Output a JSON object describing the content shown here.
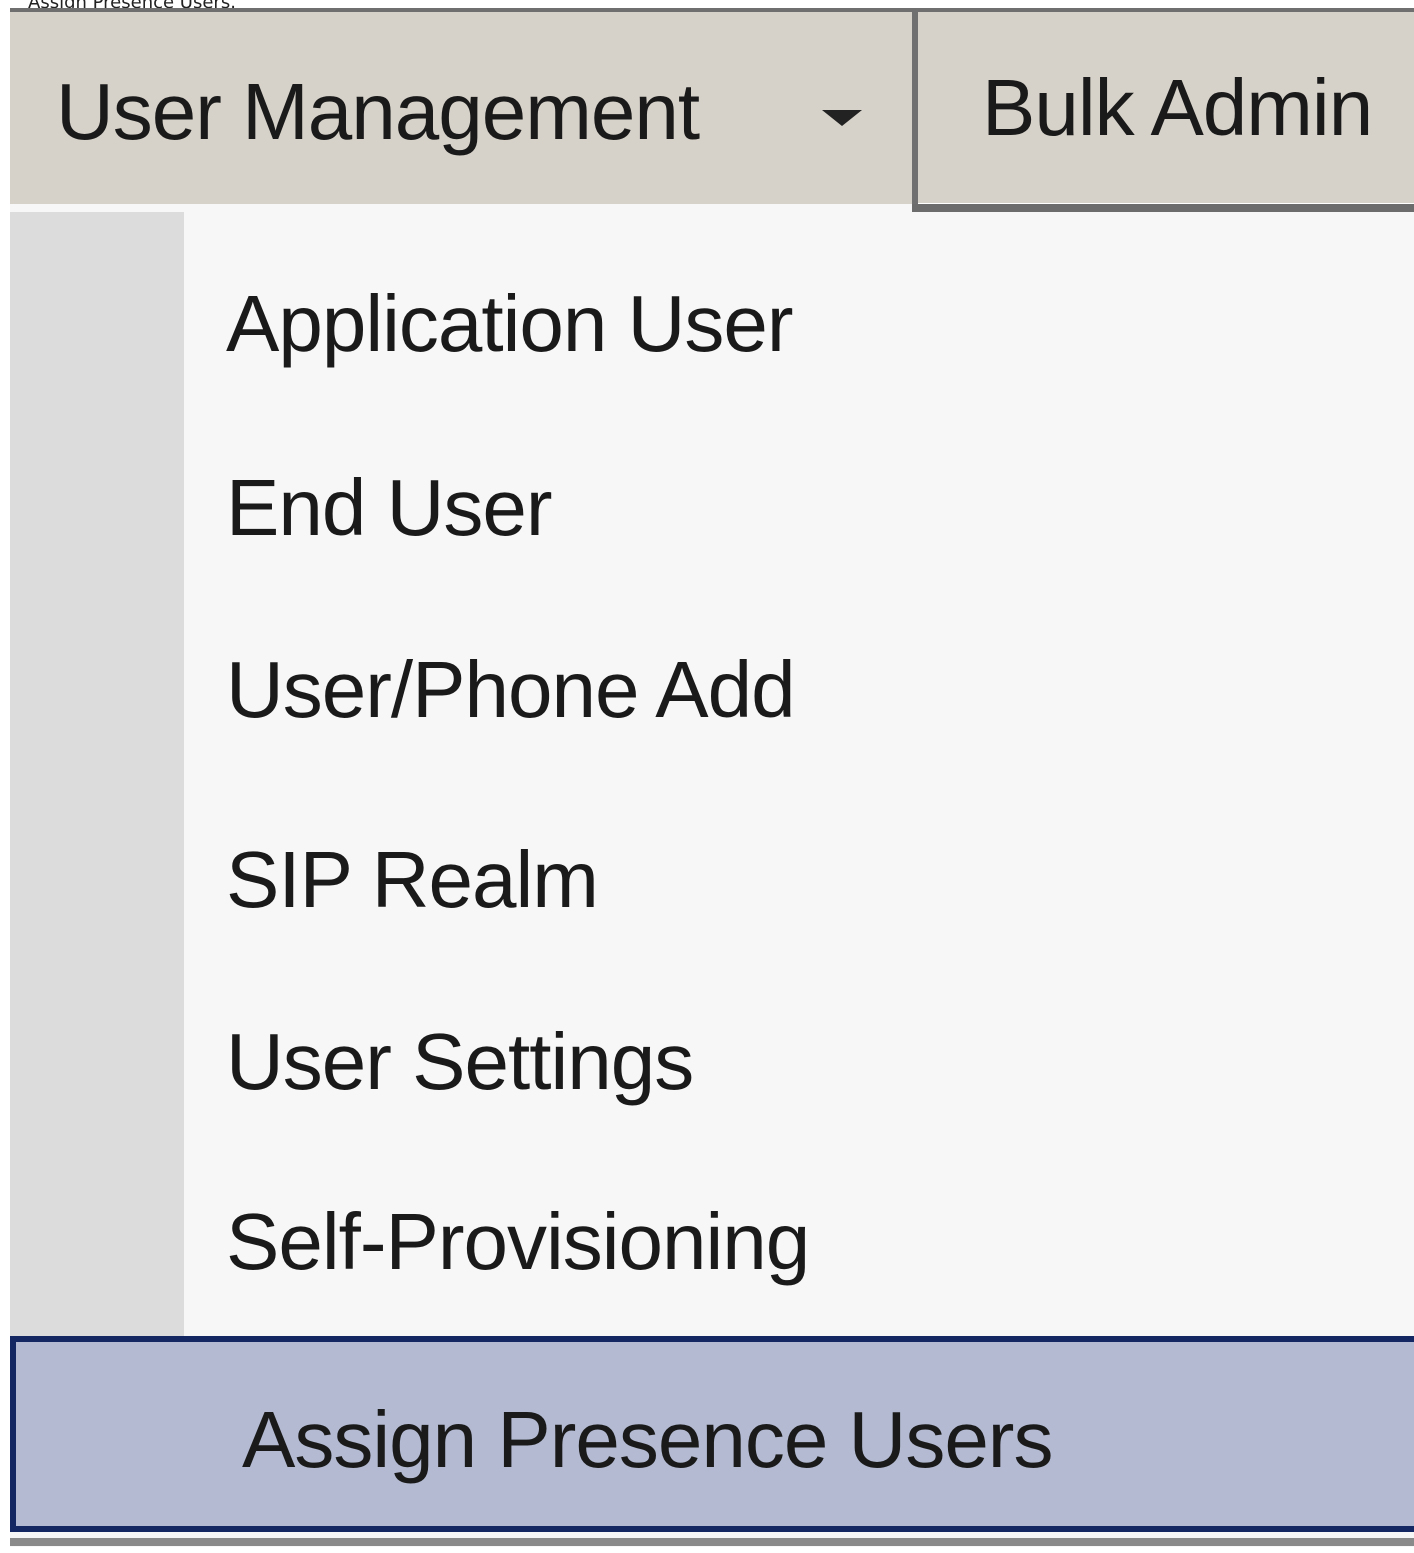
{
  "caption": "Assign Presence Users.",
  "menubar": {
    "user_management_label": "User Management",
    "bulk_admin_label": "Bulk Admin"
  },
  "dropdown": {
    "items": [
      {
        "label": "Application User"
      },
      {
        "label": "End User"
      },
      {
        "label": "User/Phone Add"
      },
      {
        "label": "SIP Realm"
      },
      {
        "label": "User Settings"
      },
      {
        "label": "Self-Provisioning"
      },
      {
        "label": "Assign Presence Users",
        "selected": true
      }
    ]
  },
  "colors": {
    "menubar_bg": "#d6d1c9",
    "dropdown_bg": "#f7f7f7",
    "gutter_bg": "#dcdcdc",
    "selected_bg": "#b3bad1",
    "selected_border": "#142763"
  }
}
